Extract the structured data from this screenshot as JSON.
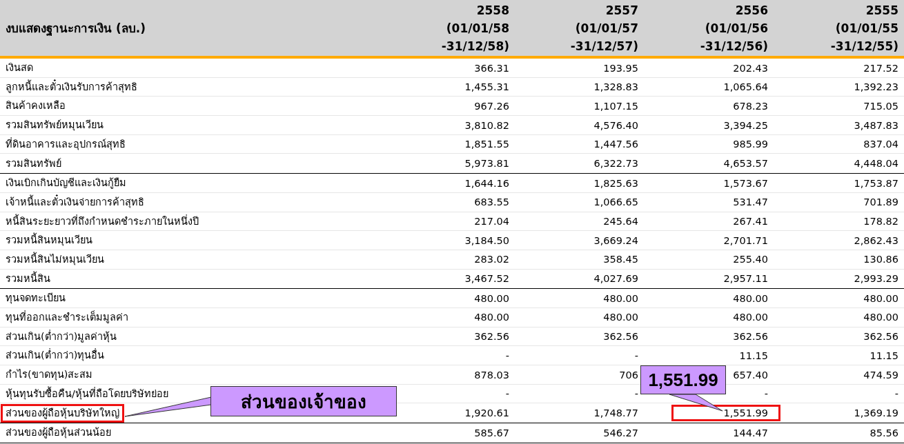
{
  "table": {
    "title": "งบแสดงฐานะการเงิน (ลบ.)",
    "columns": [
      {
        "lines": [
          "2558",
          "(01/01/58",
          "-31/12/58)"
        ]
      },
      {
        "lines": [
          "2557",
          "(01/01/57",
          "-31/12/57)"
        ]
      },
      {
        "lines": [
          "2556",
          "(01/01/56",
          "-31/12/56)"
        ]
      },
      {
        "lines": [
          "2555",
          "(01/01/55",
          "-31/12/55)"
        ]
      }
    ],
    "sections": [
      {
        "rows": [
          {
            "label": "เงินสด",
            "boxed": false,
            "values": [
              {
                "text": "366.31",
                "boxed": false
              },
              {
                "text": "193.95",
                "boxed": false
              },
              {
                "text": "202.43",
                "boxed": false
              },
              {
                "text": "217.52",
                "boxed": false
              }
            ]
          },
          {
            "label": "ลูกหนี้และตั๋วเงินรับการค้าสุทธิ",
            "boxed": false,
            "values": [
              {
                "text": "1,455.31",
                "boxed": false
              },
              {
                "text": "1,328.83",
                "boxed": false
              },
              {
                "text": "1,065.64",
                "boxed": false
              },
              {
                "text": "1,392.23",
                "boxed": false
              }
            ]
          },
          {
            "label": "สินค้าคงเหลือ",
            "boxed": false,
            "values": [
              {
                "text": "967.26",
                "boxed": false
              },
              {
                "text": "1,107.15",
                "boxed": false
              },
              {
                "text": "678.23",
                "boxed": false
              },
              {
                "text": "715.05",
                "boxed": false
              }
            ]
          },
          {
            "label": "รวมสินทรัพย์หมุนเวียน",
            "boxed": false,
            "values": [
              {
                "text": "3,810.82",
                "boxed": false
              },
              {
                "text": "4,576.40",
                "boxed": false
              },
              {
                "text": "3,394.25",
                "boxed": false
              },
              {
                "text": "3,487.83",
                "boxed": false
              }
            ]
          },
          {
            "label": "ที่ดินอาคารและอุปกรณ์สุทธิ",
            "boxed": false,
            "values": [
              {
                "text": "1,851.55",
                "boxed": false
              },
              {
                "text": "1,447.56",
                "boxed": false
              },
              {
                "text": "985.99",
                "boxed": false
              },
              {
                "text": "837.04",
                "boxed": false
              }
            ]
          },
          {
            "label": "รวมสินทรัพย์",
            "boxed": false,
            "values": [
              {
                "text": "5,973.81",
                "boxed": false
              },
              {
                "text": "6,322.73",
                "boxed": false
              },
              {
                "text": "4,653.57",
                "boxed": false
              },
              {
                "text": "4,448.04",
                "boxed": false
              }
            ]
          }
        ]
      },
      {
        "rows": [
          {
            "label": "เงินเบิกเกินบัญชีและเงินกู้ยืม",
            "boxed": false,
            "values": [
              {
                "text": "1,644.16",
                "boxed": false
              },
              {
                "text": "1,825.63",
                "boxed": false
              },
              {
                "text": "1,573.67",
                "boxed": false
              },
              {
                "text": "1,753.87",
                "boxed": false
              }
            ]
          },
          {
            "label": "เจ้าหนี้และตั๋วเงินจ่ายการค้าสุทธิ",
            "boxed": false,
            "values": [
              {
                "text": "683.55",
                "boxed": false
              },
              {
                "text": "1,066.65",
                "boxed": false
              },
              {
                "text": "531.47",
                "boxed": false
              },
              {
                "text": "701.89",
                "boxed": false
              }
            ]
          },
          {
            "label": "หนี้สินระยะยาวที่ถึงกำหนดชำระภายในหนึ่งปี",
            "boxed": false,
            "values": [
              {
                "text": "217.04",
                "boxed": false
              },
              {
                "text": "245.64",
                "boxed": false
              },
              {
                "text": "267.41",
                "boxed": false
              },
              {
                "text": "178.82",
                "boxed": false
              }
            ]
          },
          {
            "label": "รวมหนี้สินหมุนเวียน",
            "boxed": false,
            "values": [
              {
                "text": "3,184.50",
                "boxed": false
              },
              {
                "text": "3,669.24",
                "boxed": false
              },
              {
                "text": "2,701.71",
                "boxed": false
              },
              {
                "text": "2,862.43",
                "boxed": false
              }
            ]
          },
          {
            "label": "รวมหนี้สินไม่หมุนเวียน",
            "boxed": false,
            "values": [
              {
                "text": "283.02",
                "boxed": false
              },
              {
                "text": "358.45",
                "boxed": false
              },
              {
                "text": "255.40",
                "boxed": false
              },
              {
                "text": "130.86",
                "boxed": false
              }
            ]
          },
          {
            "label": "รวมหนี้สิน",
            "boxed": false,
            "values": [
              {
                "text": "3,467.52",
                "boxed": false
              },
              {
                "text": "4,027.69",
                "boxed": false
              },
              {
                "text": "2,957.11",
                "boxed": false
              },
              {
                "text": "2,993.29",
                "boxed": false
              }
            ]
          }
        ]
      },
      {
        "rows": [
          {
            "label": "ทุนจดทะเบียน",
            "boxed": false,
            "values": [
              {
                "text": "480.00",
                "boxed": false
              },
              {
                "text": "480.00",
                "boxed": false
              },
              {
                "text": "480.00",
                "boxed": false
              },
              {
                "text": "480.00",
                "boxed": false
              }
            ]
          },
          {
            "label": "ทุนที่ออกและชำระเต็มมูลค่า",
            "boxed": false,
            "values": [
              {
                "text": "480.00",
                "boxed": false
              },
              {
                "text": "480.00",
                "boxed": false
              },
              {
                "text": "480.00",
                "boxed": false
              },
              {
                "text": "480.00",
                "boxed": false
              }
            ]
          },
          {
            "label": "ส่วนเกิน(ต่ำกว่า)มูลค่าหุ้น",
            "boxed": false,
            "values": [
              {
                "text": "362.56",
                "boxed": false
              },
              {
                "text": "362.56",
                "boxed": false
              },
              {
                "text": "362.56",
                "boxed": false
              },
              {
                "text": "362.56",
                "boxed": false
              }
            ]
          },
          {
            "label": "ส่วนเกิน(ต่ำกว่า)ทุนอื่น",
            "boxed": false,
            "values": [
              {
                "text": "-",
                "boxed": false
              },
              {
                "text": "-",
                "boxed": false
              },
              {
                "text": "11.15",
                "boxed": false
              },
              {
                "text": "11.15",
                "boxed": false
              }
            ]
          },
          {
            "label": "กำไร(ขาดทุน)สะสม",
            "boxed": false,
            "values": [
              {
                "text": "878.03",
                "boxed": false
              },
              {
                "text": "706",
                "boxed": false
              },
              {
                "text": "657.40",
                "boxed": false
              },
              {
                "text": "474.59",
                "boxed": false
              }
            ]
          },
          {
            "label": "หุ้นทุนรับซื้อคืน/หุ้นที่ถือโดยบริษัทย่อย",
            "boxed": false,
            "values": [
              {
                "text": "-",
                "boxed": false
              },
              {
                "text": "-",
                "boxed": false
              },
              {
                "text": "-",
                "boxed": false
              },
              {
                "text": "-",
                "boxed": false
              }
            ]
          },
          {
            "label": "ส่วนของผู้ถือหุ้นบริษัทใหญ่",
            "boxed": true,
            "values": [
              {
                "text": "1,920.61",
                "boxed": false
              },
              {
                "text": "1,748.77",
                "boxed": false
              },
              {
                "text": "1,551.99",
                "boxed": true
              },
              {
                "text": "1,369.19",
                "boxed": false
              }
            ]
          }
        ]
      },
      {
        "rows": [
          {
            "label": "ส่วนของผู้ถือหุ้นส่วนน้อย",
            "boxed": false,
            "values": [
              {
                "text": "585.67",
                "boxed": false
              },
              {
                "text": "546.27",
                "boxed": false
              },
              {
                "text": "144.47",
                "boxed": false
              },
              {
                "text": "85.56",
                "boxed": false
              }
            ]
          }
        ]
      }
    ]
  },
  "callouts": [
    {
      "text": "ส่วนของเจ้าของ"
    },
    {
      "text": "1,551.99"
    }
  ]
}
